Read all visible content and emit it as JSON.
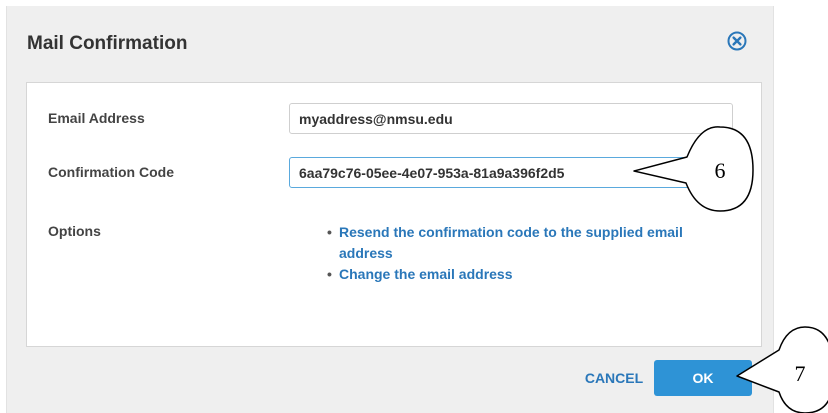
{
  "dialog": {
    "title": "Mail Confirmation",
    "close_icon": "close-circle-icon"
  },
  "form": {
    "email_label": "Email Address",
    "email_value": "myaddress@nmsu.edu",
    "code_label": "Confirmation Code",
    "code_value": "6aa79c76-05ee-4e07-953a-81a9a396f2d5",
    "options_label": "Options",
    "options": [
      "Resend the confirmation code to the supplied email address",
      "Change the email address"
    ]
  },
  "buttons": {
    "cancel": "CANCEL",
    "ok": "OK"
  },
  "colors": {
    "accent": "#2e93d6",
    "link": "#2a77b9",
    "dialog_bg": "#efefef"
  },
  "callouts": [
    "6",
    "7"
  ]
}
